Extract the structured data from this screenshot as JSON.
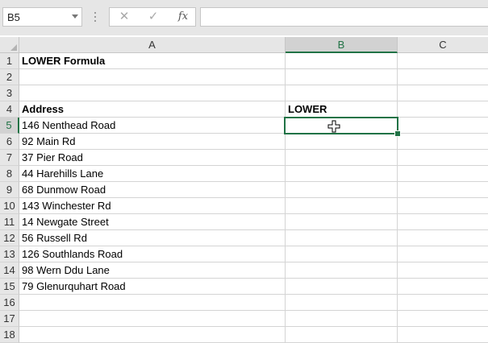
{
  "formula_bar": {
    "name_box": "B5",
    "cancel_icon": "✕",
    "enter_icon": "✓",
    "fx_label": "fx",
    "formula": ""
  },
  "columns": [
    "A",
    "B",
    "C"
  ],
  "selected_cell": "B5",
  "rows": [
    {
      "num": "1",
      "a": "LOWER Formula",
      "b": "",
      "bold": true
    },
    {
      "num": "2",
      "a": "",
      "b": ""
    },
    {
      "num": "3",
      "a": "",
      "b": ""
    },
    {
      "num": "4",
      "a": "Address",
      "b": "LOWER",
      "bold": true
    },
    {
      "num": "5",
      "a": "146 Nenthead Road",
      "b": ""
    },
    {
      "num": "6",
      "a": "92 Main Rd",
      "b": ""
    },
    {
      "num": "7",
      "a": "37 Pier Road",
      "b": ""
    },
    {
      "num": "8",
      "a": "44 Harehills Lane",
      "b": ""
    },
    {
      "num": "9",
      "a": "68 Dunmow Road",
      "b": ""
    },
    {
      "num": "10",
      "a": "143 Winchester Rd",
      "b": ""
    },
    {
      "num": "11",
      "a": "14 Newgate Street",
      "b": ""
    },
    {
      "num": "12",
      "a": "56 Russell Rd",
      "b": ""
    },
    {
      "num": "13",
      "a": "126 Southlands Road",
      "b": ""
    },
    {
      "num": "14",
      "a": "98 Wern Ddu Lane",
      "b": ""
    },
    {
      "num": "15",
      "a": "79 Glenurquhart Road",
      "b": ""
    },
    {
      "num": "16",
      "a": "",
      "b": ""
    },
    {
      "num": "17",
      "a": "",
      "b": ""
    },
    {
      "num": "18",
      "a": "",
      "b": ""
    }
  ],
  "accent_color": "#217346"
}
